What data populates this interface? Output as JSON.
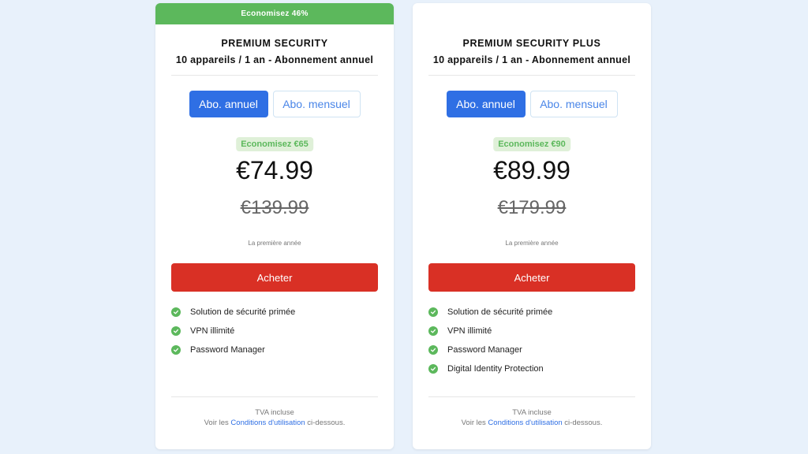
{
  "plans": [
    {
      "ribbon": "Economisez 46%",
      "title": "PREMIUM SECURITY",
      "subtitle": "10 appareils / 1 an - Abonnement annuel",
      "tab_annual": "Abo. annuel",
      "tab_monthly": "Abo. mensuel",
      "save_badge": "Economisez €65",
      "price": "€74.99",
      "old_price": "€139.99",
      "period": "La première année",
      "buy_label": "Acheter",
      "features": [
        "Solution de sécurité primée",
        "VPN illimité",
        "Password Manager"
      ],
      "footer_tax": "TVA incluse",
      "footer_prefix": "Voir les",
      "footer_link": "Conditions d'utilisation",
      "footer_suffix": "ci-dessous."
    },
    {
      "title": "PREMIUM SECURITY PLUS",
      "subtitle": "10 appareils / 1 an - Abonnement annuel",
      "tab_annual": "Abo. annuel",
      "tab_monthly": "Abo. mensuel",
      "save_badge": "Economisez €90",
      "price": "€89.99",
      "old_price": "€179.99",
      "period": "La première année",
      "buy_label": "Acheter",
      "features": [
        "Solution de sécurité primée",
        "VPN illimité",
        "Password Manager",
        "Digital Identity Protection"
      ],
      "footer_tax": "TVA incluse",
      "footer_prefix": "Voir les",
      "footer_link": "Conditions d'utilisation",
      "footer_suffix": "ci-dessous."
    }
  ],
  "colors": {
    "background": "#e8f1fb",
    "accent_blue": "#2f6fe4",
    "buy_red": "#d93025",
    "savings_green": "#5cb85c"
  }
}
